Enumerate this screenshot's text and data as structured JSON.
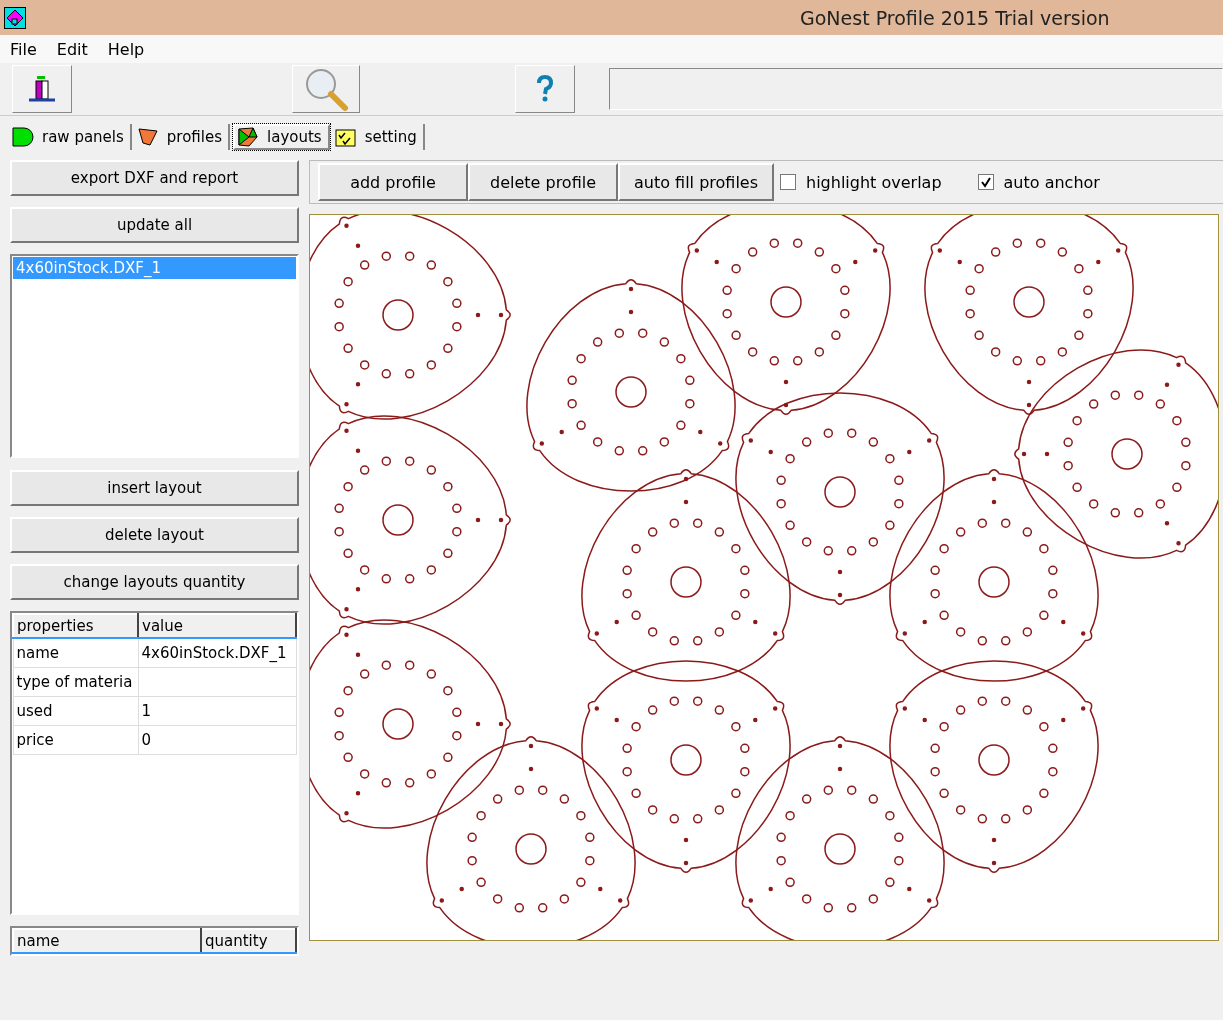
{
  "window": {
    "title": "GoNest Profile 2015 Trial version"
  },
  "menu": [
    "File",
    "Edit",
    "Help"
  ],
  "tabs": [
    {
      "label": "raw panels",
      "selected": false,
      "kind": "panel"
    },
    {
      "label": "profiles",
      "selected": false,
      "kind": "profile"
    },
    {
      "label": "layouts",
      "selected": true,
      "kind": "layout"
    },
    {
      "label": "setting",
      "selected": false,
      "kind": "setting"
    }
  ],
  "sidebar": {
    "top_buttons": [
      "export DXF and report",
      "update all"
    ],
    "layouts": [
      {
        "label": "4x60inStock.DXF_1",
        "selected": true
      }
    ],
    "layout_buttons": [
      "insert layout",
      "delete layout",
      "change layouts quantity"
    ],
    "properties": {
      "columns": [
        "properties",
        "value"
      ],
      "rows": [
        [
          "name",
          "4x60inStock.DXF_1"
        ],
        [
          "type of materia",
          ""
        ],
        [
          "used",
          "1"
        ],
        [
          "price",
          "0"
        ]
      ]
    },
    "parts_table": {
      "columns": [
        "name",
        "quantity"
      ]
    }
  },
  "layout_toolbar": {
    "buttons": [
      "add profile",
      "delete profile",
      "auto fill profiles"
    ],
    "checkboxes": [
      {
        "label": "highlight overlap",
        "checked": false
      },
      {
        "label": "auto anchor",
        "checked": true
      }
    ]
  }
}
